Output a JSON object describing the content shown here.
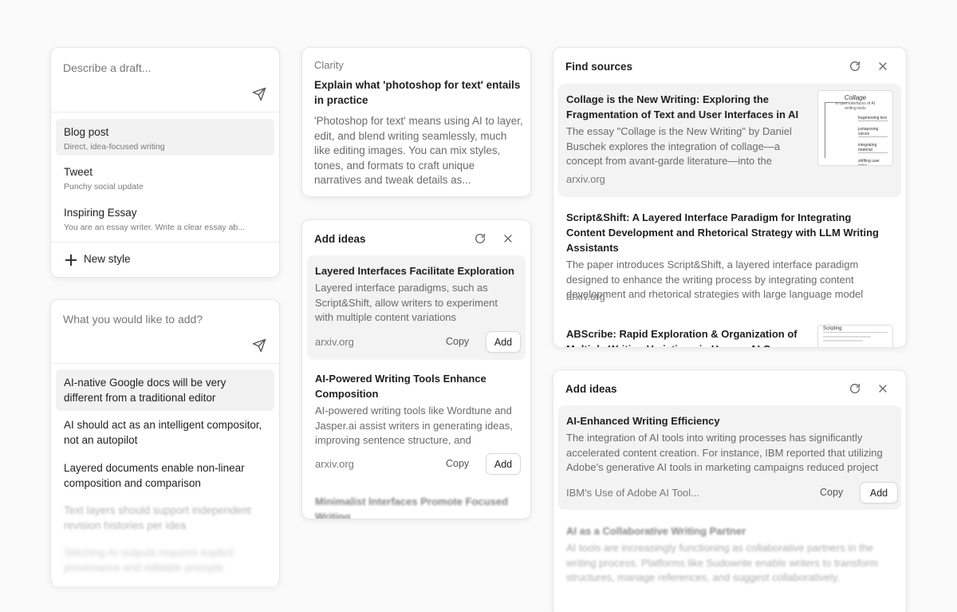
{
  "draft_card": {
    "placeholder": "Describe a draft...",
    "styles": [
      {
        "name": "Blog post",
        "desc": "Direct, idea-focused writing"
      },
      {
        "name": "Tweet",
        "desc": "Punchy social update"
      },
      {
        "name": "Inspiring Essay",
        "desc": "You are an essay writer. Write a clear essay ab..."
      }
    ],
    "new_style_label": "New style"
  },
  "add_card": {
    "placeholder": "What you would like to add?",
    "ideas": [
      "AI-native Google docs will be very different from a traditional editor",
      "AI should act as an intelligent compositor, not an autopilot",
      "Layered documents enable non-linear composition and comparison",
      "Text layers should support independent revision histories per idea",
      "Stitching AI outputs requires explicit provenance and editable prompts"
    ]
  },
  "clarity_card": {
    "label": "Clarity",
    "question": "Explain what 'photoshop for text' entails in practice",
    "answer": "'Photoshop for text' means using AI to layer, edit, and blend writing seamlessly, much like editing images. You can mix styles, tones, and formats to craft unique narratives and tweak details as..."
  },
  "add_ideas_mid": {
    "title": "Add ideas",
    "items": [
      {
        "title": "Layered Interfaces Facilitate Exploration",
        "body": "Layered interface paradigms, such as Script&Shift, allow writers to experiment with multiple content variations simultaneously...",
        "source": "arxiv.org",
        "copy": "Copy",
        "add": "Add"
      },
      {
        "title": "AI-Powered Writing Tools Enhance Composition",
        "body": "AI-powered writing tools like Wordtune and Jasper.ai assist writers in generating ideas, improving sentence structure, and maintaining...",
        "source": "arxiv.org",
        "copy": "Copy",
        "add": "Add"
      },
      {
        "title": "Minimalist Interfaces Promote Focused Writing",
        "body": "",
        "source": "",
        "copy": "",
        "add": ""
      }
    ]
  },
  "find_sources": {
    "title": "Find sources",
    "items": [
      {
        "title": "Collage is the New Writing: Exploring the Fragmentation of Text and User Interfaces in AI",
        "body": "The essay \"Collage is the New Writing\" by Daniel Buschek explores the integration of collage—a concept from avant-garde literature—into the design...",
        "source": "arxiv.org",
        "thumb": {
          "heading": "Collage",
          "sub": "in user interfaces of AI writing tools",
          "rows": [
            "fragmenting text",
            "juxtaposing voices",
            "integrating material",
            "shifting user roles"
          ]
        }
      },
      {
        "title": "Script&Shift: A Layered Interface Paradigm for Integrating Content Development and Rhetorical Strategy with LLM Writing Assistants",
        "body": "The paper introduces Script&Shift, a layered interface paradigm designed to enhance the writing process by integrating content development and rhetorical strategies with large language model (LLM)...",
        "source": "arxiv.org"
      },
      {
        "title": "ABScribe: Rapid Exploration & Organization of Multiple Writing Variations in Human-AI Co-Writing",
        "body": "",
        "source": "",
        "thumb": {
          "heading": "Scripting"
        }
      }
    ]
  },
  "add_ideas_right": {
    "title": "Add ideas",
    "items": [
      {
        "title": "AI-Enhanced Writing Efficiency",
        "body": "The integration of AI tools into writing processes has significantly accelerated content creation. For instance, IBM reported that utilizing Adobe's generative AI tools in marketing campaigns reduced project timelines...",
        "source": "IBM's Use of Adobe AI Tool...",
        "copy": "Copy",
        "add": "Add"
      },
      {
        "title": "AI as a Collaborative Writing Partner",
        "body": "AI tools are increasingly functioning as collaborative partners in the writing process. Platforms like Sudowrite enable writers to transform structures, manage references, and suggest collaboratively, dynamically...",
        "source": "",
        "copy": "",
        "add": ""
      }
    ]
  }
}
